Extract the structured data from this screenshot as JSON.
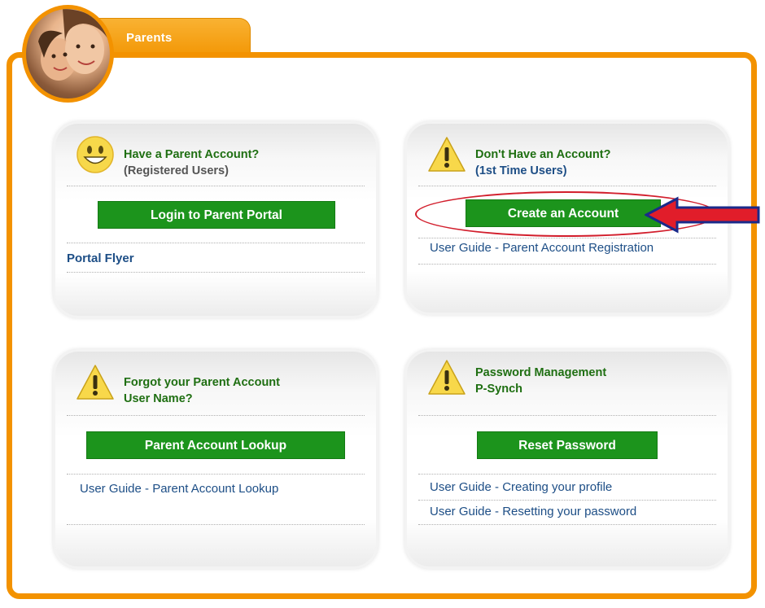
{
  "header": {
    "tab_label": "Parents"
  },
  "panels": {
    "have_account": {
      "title": "Have a Parent Account?",
      "subtitle": "(Registered Users)",
      "button": "Login to Parent Portal",
      "links": [
        "Portal Flyer"
      ]
    },
    "no_account": {
      "title": "Don't Have an Account?",
      "subtitle": "(1st Time Users)",
      "button": "Create an Account",
      "links": [
        "User Guide - Parent Account Registration"
      ]
    },
    "forgot_username": {
      "title_line1": "Forgot your Parent Account",
      "title_line2": "User Name?",
      "button": "Parent Account Lookup",
      "links": [
        "User Guide - Parent Account Lookup"
      ]
    },
    "password_mgmt": {
      "title_line1": "Password Management",
      "title_line2": "P-Synch",
      "button": "Reset Password",
      "links": [
        "User Guide - Creating your profile",
        "User Guide - Resetting your password"
      ]
    }
  },
  "icons": {
    "avatar": "parent-child-photo",
    "smiley": "smiley-face-icon",
    "warning": "warning-icon",
    "annotation": "red-arrow-icon"
  },
  "colors": {
    "frame_orange": "#f39200",
    "title_green": "#1f6f12",
    "button_green": "#1c941c",
    "link_blue": "#1d4e86",
    "annotation_red": "#d21e2c"
  }
}
